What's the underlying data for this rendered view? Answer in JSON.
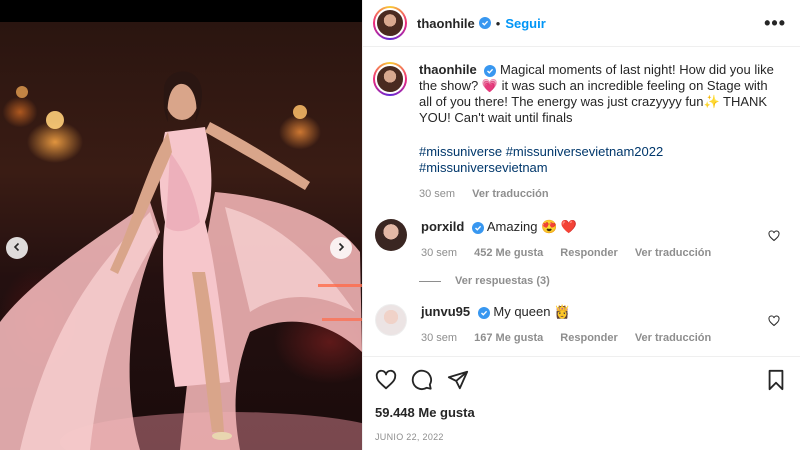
{
  "post": {
    "username": "thaonhile",
    "follow_label": "Seguir",
    "more_label": "•••",
    "caption": "Magical moments of last night! How did you like the show? 💗 it was such an incredible feeling on Stage with all of you there! The energy was just crazyyyy fun✨ THANK YOU! Can't wait until finals",
    "hashtags": "#missuniverse #missuniversevietnam2022 #missuniversevietnam",
    "time": "30 sem",
    "see_translation": "Ver traducción",
    "likes": "59.448 Me gusta",
    "date": "JUNIO 22, 2022"
  },
  "comments": [
    {
      "username": "porxild",
      "text": "Amazing 😍 ❤️",
      "time": "30 sem",
      "likes": "452 Me gusta",
      "reply": "Responder",
      "translate": "Ver traducción",
      "view_replies": "Ver respuestas (3)"
    },
    {
      "username": "junvu95",
      "text": "My queen 👸",
      "time": "30 sem",
      "likes": "167 Me gusta",
      "reply": "Responder",
      "translate": "Ver traducción"
    }
  ],
  "third_comment_text": "😍😍😍😍😍",
  "icons": {
    "verified": "verified-badge-icon",
    "more": "more-options-icon",
    "like": "heart-icon",
    "comment": "comment-icon",
    "share": "share-icon",
    "save": "bookmark-icon",
    "prev": "chevron-left-icon",
    "next": "chevron-right-icon"
  },
  "colors": {
    "accent": "#0095f6",
    "verified": "#3897f0",
    "hashtag": "#00376b",
    "muted": "#8e8e8e"
  }
}
